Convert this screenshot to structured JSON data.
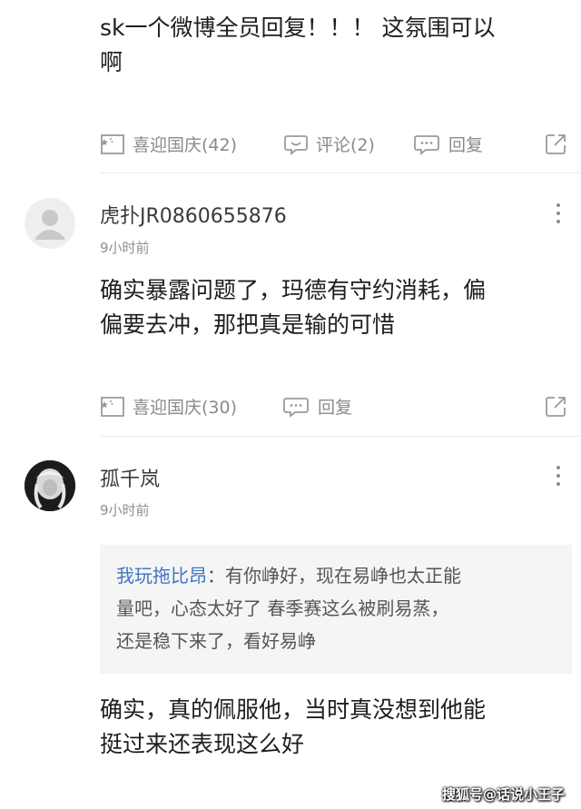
{
  "post_tail": {
    "text_line1": "sk一个微博全员回复！！！ 这氛围可以",
    "text_line2": "啊",
    "actions": {
      "like": "喜迎国庆(42)",
      "comment": "评论(2)",
      "reply": "回复"
    }
  },
  "comments": [
    {
      "username": "虎扑JR0860655876",
      "time": "9小时前",
      "text_line1": "确实暴露问题了，玛德有守约消耗，偏",
      "text_line2": "偏要去冲，那把真是输的可惜",
      "actions": {
        "like": "喜迎国庆(30)",
        "reply": "回复"
      }
    },
    {
      "username": "孤千岚",
      "time": "9小时前",
      "quote": {
        "author": "我玩拖比昂",
        "separator": "：",
        "line1": "有你峥好，现在易峥也太正能",
        "line2": "量吧，心态太好了 春季赛这么被刷易蒸，",
        "line3": "还是稳下来了，看好易峥"
      },
      "text_line1": "确实，真的佩服他，当时真没想到他能",
      "text_line2": "挺过来还表现这么好"
    }
  ],
  "watermark": "搜狐号@话说小王子",
  "colors": {
    "link_blue": "#3f76c2",
    "muted_gray": "#8a8a8a",
    "divider": "#ececec",
    "quote_bg": "#f5f5f5"
  }
}
